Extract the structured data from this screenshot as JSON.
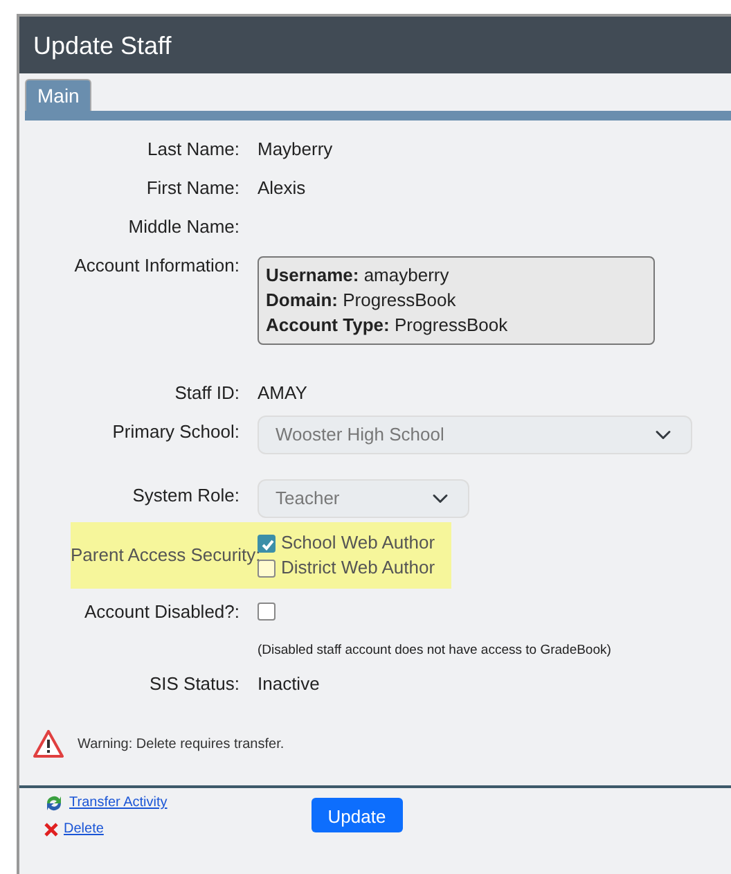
{
  "window": {
    "title": "Update Staff"
  },
  "tabs": [
    {
      "label": "Main",
      "selected": true
    }
  ],
  "fields": [
    {
      "kind": "text",
      "label": "Last Name:",
      "value": "Mayberry"
    },
    {
      "kind": "text",
      "label": "First Name:",
      "value": "Alexis"
    },
    {
      "kind": "text",
      "label": "Middle Name:"
    },
    {
      "kind": "account",
      "label": "Account Information:",
      "lines": [
        {
          "key": "Username:",
          "value": "amayberry"
        },
        {
          "key": "Domain:",
          "value": "ProgressBook"
        },
        {
          "key": "Account Type:",
          "value": "ProgressBook"
        }
      ]
    },
    {
      "kind": "text",
      "label": "Staff ID:",
      "value": "AMAY"
    },
    {
      "kind": "select",
      "label": "Primary School:",
      "value": "Wooster High School",
      "disabled": true
    },
    {
      "kind": "select",
      "label": "System Role:",
      "value": "Teacher",
      "disabled": true
    },
    {
      "kind": "checkgroup",
      "label": "Parent Access Security:",
      "highlighted": true,
      "options": [
        {
          "label": "School Web Author",
          "checked": true
        },
        {
          "label": "District Web Author",
          "checked": false
        }
      ]
    },
    {
      "kind": "checkbox",
      "label": "Account Disabled?:",
      "checked": false,
      "note": "(Disabled staff account does not have access to GradeBook)"
    },
    {
      "kind": "text",
      "label": "SIS Status:",
      "value": "Inactive"
    }
  ],
  "warning": "Warning: Delete requires transfer.",
  "links": [
    {
      "kind": "transfer",
      "label": "Transfer Activity"
    },
    {
      "kind": "delete",
      "label": "Delete"
    }
  ],
  "button": "Update"
}
